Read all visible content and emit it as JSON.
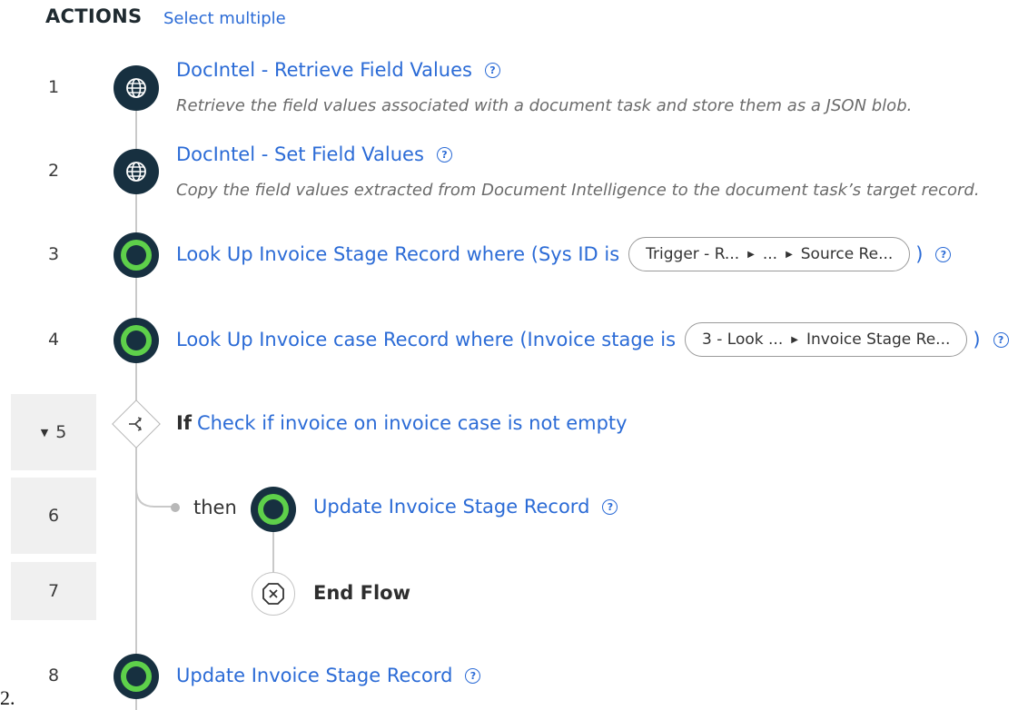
{
  "header": {
    "title": "ACTIONS",
    "select_multiple": "Select multiple"
  },
  "steps": [
    {
      "number": "1",
      "title": "DocIntel - Retrieve Field Values",
      "description": "Retrieve the field values associated with a document task and store them as a JSON blob.",
      "icon": "globe-icon"
    },
    {
      "number": "2",
      "title": "DocIntel - Set Field Values",
      "description": "Copy the field values extracted from Document Intelligence to the document task’s target record.",
      "icon": "globe-icon"
    },
    {
      "number": "3",
      "title": "Look Up Invoice Stage Record where (Sys ID is",
      "pill": [
        "Trigger - R...",
        "...",
        "Source Re..."
      ],
      "close": ")",
      "icon": "record-icon"
    },
    {
      "number": "4",
      "title": "Look Up Invoice case Record where (Invoice stage is",
      "pill": [
        "3 - Look ...",
        "Invoice Stage Re..."
      ],
      "close": ")",
      "icon": "record-icon"
    },
    {
      "number": "5",
      "if_label": "If",
      "title": "Check if invoice on invoice case is not empty",
      "icon": "branch-icon"
    },
    {
      "number": "6",
      "then_label": "then",
      "title": "Update Invoice Stage Record",
      "icon": "record-icon"
    },
    {
      "number": "7",
      "title": "End Flow",
      "icon": "end-flow-icon"
    },
    {
      "number": "8",
      "title": "Update Invoice Stage Record",
      "icon": "record-icon"
    }
  ],
  "stray_text": "2.",
  "colors": {
    "link": "#2b6bd6",
    "node_dark": "#173040",
    "node_green": "#5ed04a",
    "row_shade": "#f0f0f0"
  }
}
